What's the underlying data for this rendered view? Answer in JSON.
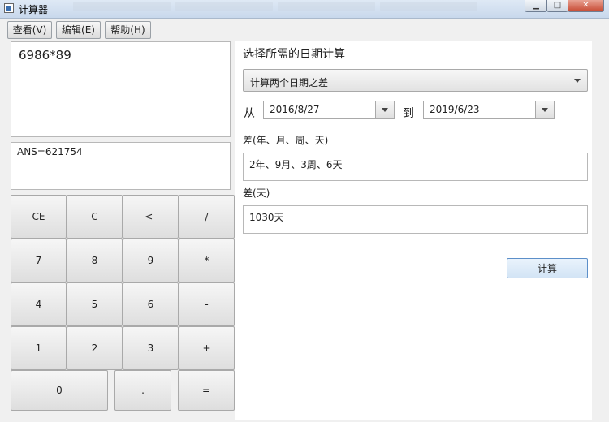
{
  "window": {
    "title": "计算器",
    "minimize_glyph": "▁",
    "maximize_glyph": "□",
    "close_glyph": "✕"
  },
  "menu": {
    "view": "查看(V)",
    "edit": "编辑(E)",
    "help": "帮助(H)"
  },
  "calculator": {
    "expression": "6986*89",
    "answer": "ANS=621754",
    "keys": {
      "ce": "CE",
      "c": "C",
      "backspace": "<-",
      "divide": "/",
      "seven": "7",
      "eight": "8",
      "nine": "9",
      "multiply": "*",
      "four": "4",
      "five": "5",
      "six": "6",
      "minus": "-",
      "one": "1",
      "two": "2",
      "three": "3",
      "plus": "+",
      "zero": "0",
      "dot": ".",
      "equals": "="
    }
  },
  "date_calc": {
    "heading": "选择所需的日期计算",
    "mode_selected": "计算两个日期之差",
    "from_label": "从",
    "from_date": "2016/8/27",
    "to_label": "到",
    "to_date": "2019/6/23",
    "diff_ymwd_label": "差(年、月、周、天)",
    "diff_ymwd_value": "2年、9月、3周、6天",
    "diff_days_label": "差(天)",
    "diff_days_value": "1030天",
    "calculate_button": "计算"
  }
}
